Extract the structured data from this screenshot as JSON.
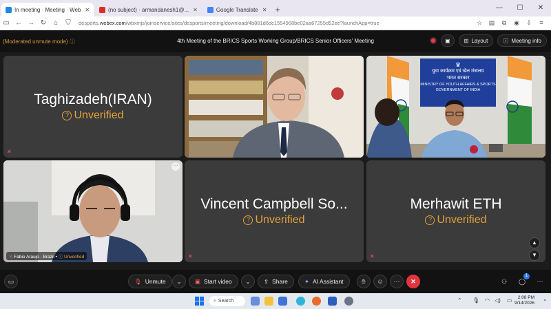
{
  "browser": {
    "tabs": [
      {
        "label": "In meeting · Meeting · Web",
        "active": true,
        "color": "#1e88e5"
      },
      {
        "label": "(no subject) · armandanesh1@...",
        "active": false,
        "color": "#d93025"
      },
      {
        "label": "Google Translate",
        "active": false,
        "color": "#4285f4"
      }
    ],
    "new_tab": "+",
    "url_prefix": "desports.",
    "url_domain": "webex.com",
    "url_path": "/wbxmjs/joinservice/sites/desports/meeting/download/4b881d6dc1554968be02aa67255d52ee?launchApp=true"
  },
  "meeting": {
    "mode_label": "(Moderated unmute mode)",
    "title": "4th Meeting of the BRICS Sports Working Group/BRICS Senior Officers' Meeting",
    "layout_label": "Layout",
    "info_label": "Meeting info"
  },
  "tiles": {
    "t1": {
      "name": "Taghizadeh(IRAN)",
      "status": "Unverified"
    },
    "t5": {
      "name": "Vincent Campbell So...",
      "status": "Unverified"
    },
    "t6": {
      "name": "Merhawit ETH",
      "status": "Unverified"
    },
    "t4": {
      "label": "Fabio Araujo - Brazil",
      "status": "Unverified"
    },
    "t3": {
      "banner_line1": "युवा कार्यक्रम एवं खेल मंत्रालय",
      "banner_line2": "भारत सरकार",
      "banner_line3": "MINISTRY OF YOUTH AFFAIRS & SPORTS",
      "banner_line4": "GOVERNMENT OF INDIA"
    }
  },
  "controls": {
    "mute_label": "Unmute",
    "video_label": "Start video",
    "share_label": "Share",
    "ai_label": "AI Assistant",
    "more": "···",
    "notif_count": "1"
  },
  "taskbar": {
    "search_label": "Search",
    "time": "2:08 PM",
    "date": "9/14/2026"
  },
  "colors": {
    "accent_unverified": "#e4a23a",
    "leave_red": "#e0343f",
    "mode_orange": "#d89a3c"
  }
}
